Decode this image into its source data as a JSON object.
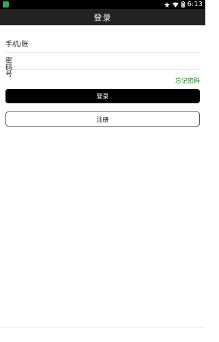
{
  "status_bar": {
    "time": "6:13",
    "icons": [
      "android-app-icon",
      "star-icon",
      "wifi-icon",
      "battery-icon"
    ]
  },
  "app_bar": {
    "title": "登录"
  },
  "form": {
    "phone_placeholder": "手机/账",
    "password_placeholder": "密码号",
    "forgot_password": "忘记密码",
    "login_button": "登录",
    "register_button": "注册"
  },
  "colors": {
    "status_bar": "#000000",
    "app_bar": "#222222",
    "link": "#2e7d32",
    "primary_button": "#000000"
  }
}
